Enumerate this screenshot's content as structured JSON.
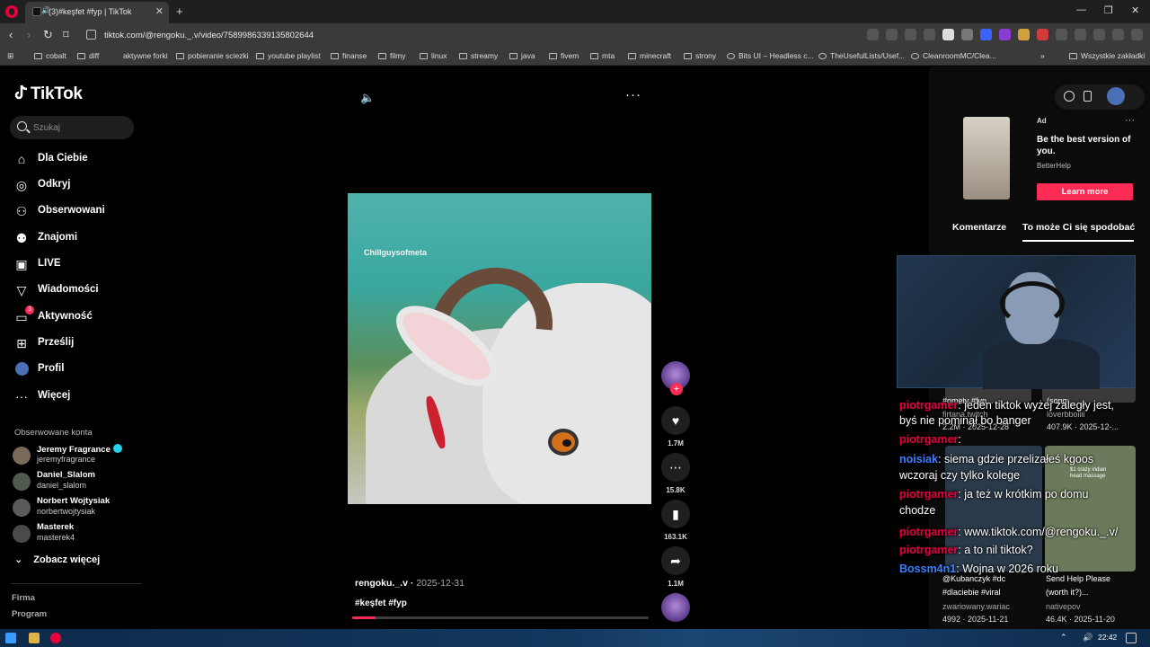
{
  "browser": {
    "tab_title": "(3)#keşfet #fyp | TikTok",
    "new_tab": "+",
    "url": "tiktok.com/@rengoku._.v/video/7589986339135802644",
    "window_controls": [
      "—",
      "❐",
      "✕"
    ],
    "bookmarks": [
      "cobalt",
      "diff",
      "aktywne forki",
      "pobieranie sciezki",
      "youtube playlist",
      "finanse",
      "filmy",
      "linux",
      "streamy",
      "java",
      "fivem",
      "mta",
      "minecraft",
      "strony",
      "Bits UI – Headless c...",
      "TheUsefulLists/Usef...",
      "CleanroomMC/Clea..."
    ],
    "all_bookmarks": "Wszystkie zakładki"
  },
  "tiktok": {
    "logo": "TikTok",
    "search_placeholder": "Szukaj",
    "nav": [
      {
        "label": "Dla Ciebie",
        "icon": "home-icon"
      },
      {
        "label": "Odkryj",
        "icon": "compass-icon"
      },
      {
        "label": "Obserwowani",
        "icon": "following-icon"
      },
      {
        "label": "Znajomi",
        "icon": "friends-icon"
      },
      {
        "label": "LIVE",
        "icon": "live-icon"
      },
      {
        "label": "Wiadomości",
        "icon": "messages-icon"
      },
      {
        "label": "Aktywność",
        "icon": "activity-icon",
        "badge": "3"
      },
      {
        "label": "Prześlij",
        "icon": "upload-icon"
      },
      {
        "label": "Profil",
        "icon": "profile-icon"
      },
      {
        "label": "Więcej",
        "icon": "more-icon"
      }
    ],
    "followed_title": "Obserwowane konta",
    "followed": [
      {
        "name": "Jeremy Fragrance",
        "handle": "jeremyfragrance",
        "verified": true
      },
      {
        "name": "Daniel_Slalom",
        "handle": "daniel_slalom"
      },
      {
        "name": "Norbert Wojtysiak",
        "handle": "norbertwojtysiak"
      },
      {
        "name": "Masterek",
        "handle": "masterek4"
      }
    ],
    "see_more": "Zobacz więcej",
    "footer": [
      "Firma",
      "Program"
    ],
    "video": {
      "watermark": "Chillguysofmeta",
      "author": "rengoku._.v",
      "date": "2025-12-31",
      "tags": "#keşfet #fyp",
      "progress": 0.08,
      "likes": "1.7M",
      "comments": "15.8K",
      "saves": "163.1K",
      "shares": "1.1M"
    },
    "ad": {
      "label": "Ad",
      "title": "Be the best version of you.",
      "brand": "BetterHelp",
      "cta": "Learn more"
    },
    "right_tabs": [
      "Komentarze",
      "To może Ci się spodobać"
    ]
  },
  "chat": [
    {
      "user": "piotrgamer",
      "text": ": jeden tiktok wyżej zaległy jest,"
    },
    {
      "user": "",
      "text": "byś nie pominął bo banger"
    },
    {
      "user": "piotrgamer",
      "text": ":"
    },
    {
      "user": "noisiak",
      "text": ": siema gdzie przelizałeś kgoos",
      "blue": true
    },
    {
      "user": "",
      "text": "wczoraj czy tylko kolege"
    },
    {
      "user": "piotrgamer",
      "text": ": ja też w krótkim po domu"
    },
    {
      "user": "",
      "text": "chodze"
    },
    {
      "user": "piotrgamer",
      "text": ": www.tiktok.com/@rengoku._.v/"
    },
    {
      "user": "piotrgamer",
      "text": ": a to nil tiktok?"
    },
    {
      "user": "Bossm4n1",
      "text": ": Wojna w 2026 roku",
      "blue": true
    }
  ],
  "recs": [
    {
      "title": "#ometv #fyp...",
      "author": "firtana.twitch",
      "stats": "2.2M · 2025-12-28"
    },
    {
      "title": "(song:...",
      "author": "loverbboiiii",
      "stats": "407.9K · 2025-12-..."
    },
    {
      "title": "@Kubanczyk #dc",
      "sub": "#dlaciebie #viral",
      "author": "zwariowany.wariac",
      "stats": "4992 · 2025-11-21"
    },
    {
      "title": "Send Help Please",
      "sub": "(worth it?)...",
      "author": "nativepov",
      "stats": "46.4K · 2025-11-20"
    }
  ],
  "rec_thumb_caption": "$1 crazy indian head massage",
  "taskbar": {
    "clock": "22:42"
  }
}
